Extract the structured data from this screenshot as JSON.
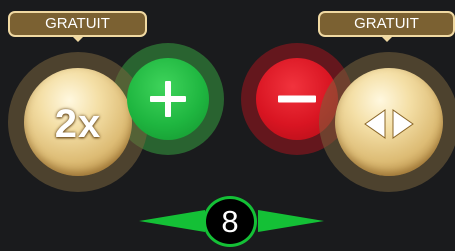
{
  "badges": {
    "left_label": "GRATUIT",
    "right_label": "GRATUIT"
  },
  "buttons": {
    "double_label": "2x",
    "plus_icon": "plus-icon",
    "minus_icon": "minus-icon",
    "swap_icon": "left-right-arrows-icon"
  },
  "stepper": {
    "value": "8",
    "left_icon": "triangle-left-icon",
    "right_icon": "triangle-right-icon"
  },
  "colors": {
    "background": "#1a1b1d",
    "gold": "#ddbc75",
    "badge_fill": "#7b6132",
    "green": "#14c036",
    "red": "#d91522"
  }
}
